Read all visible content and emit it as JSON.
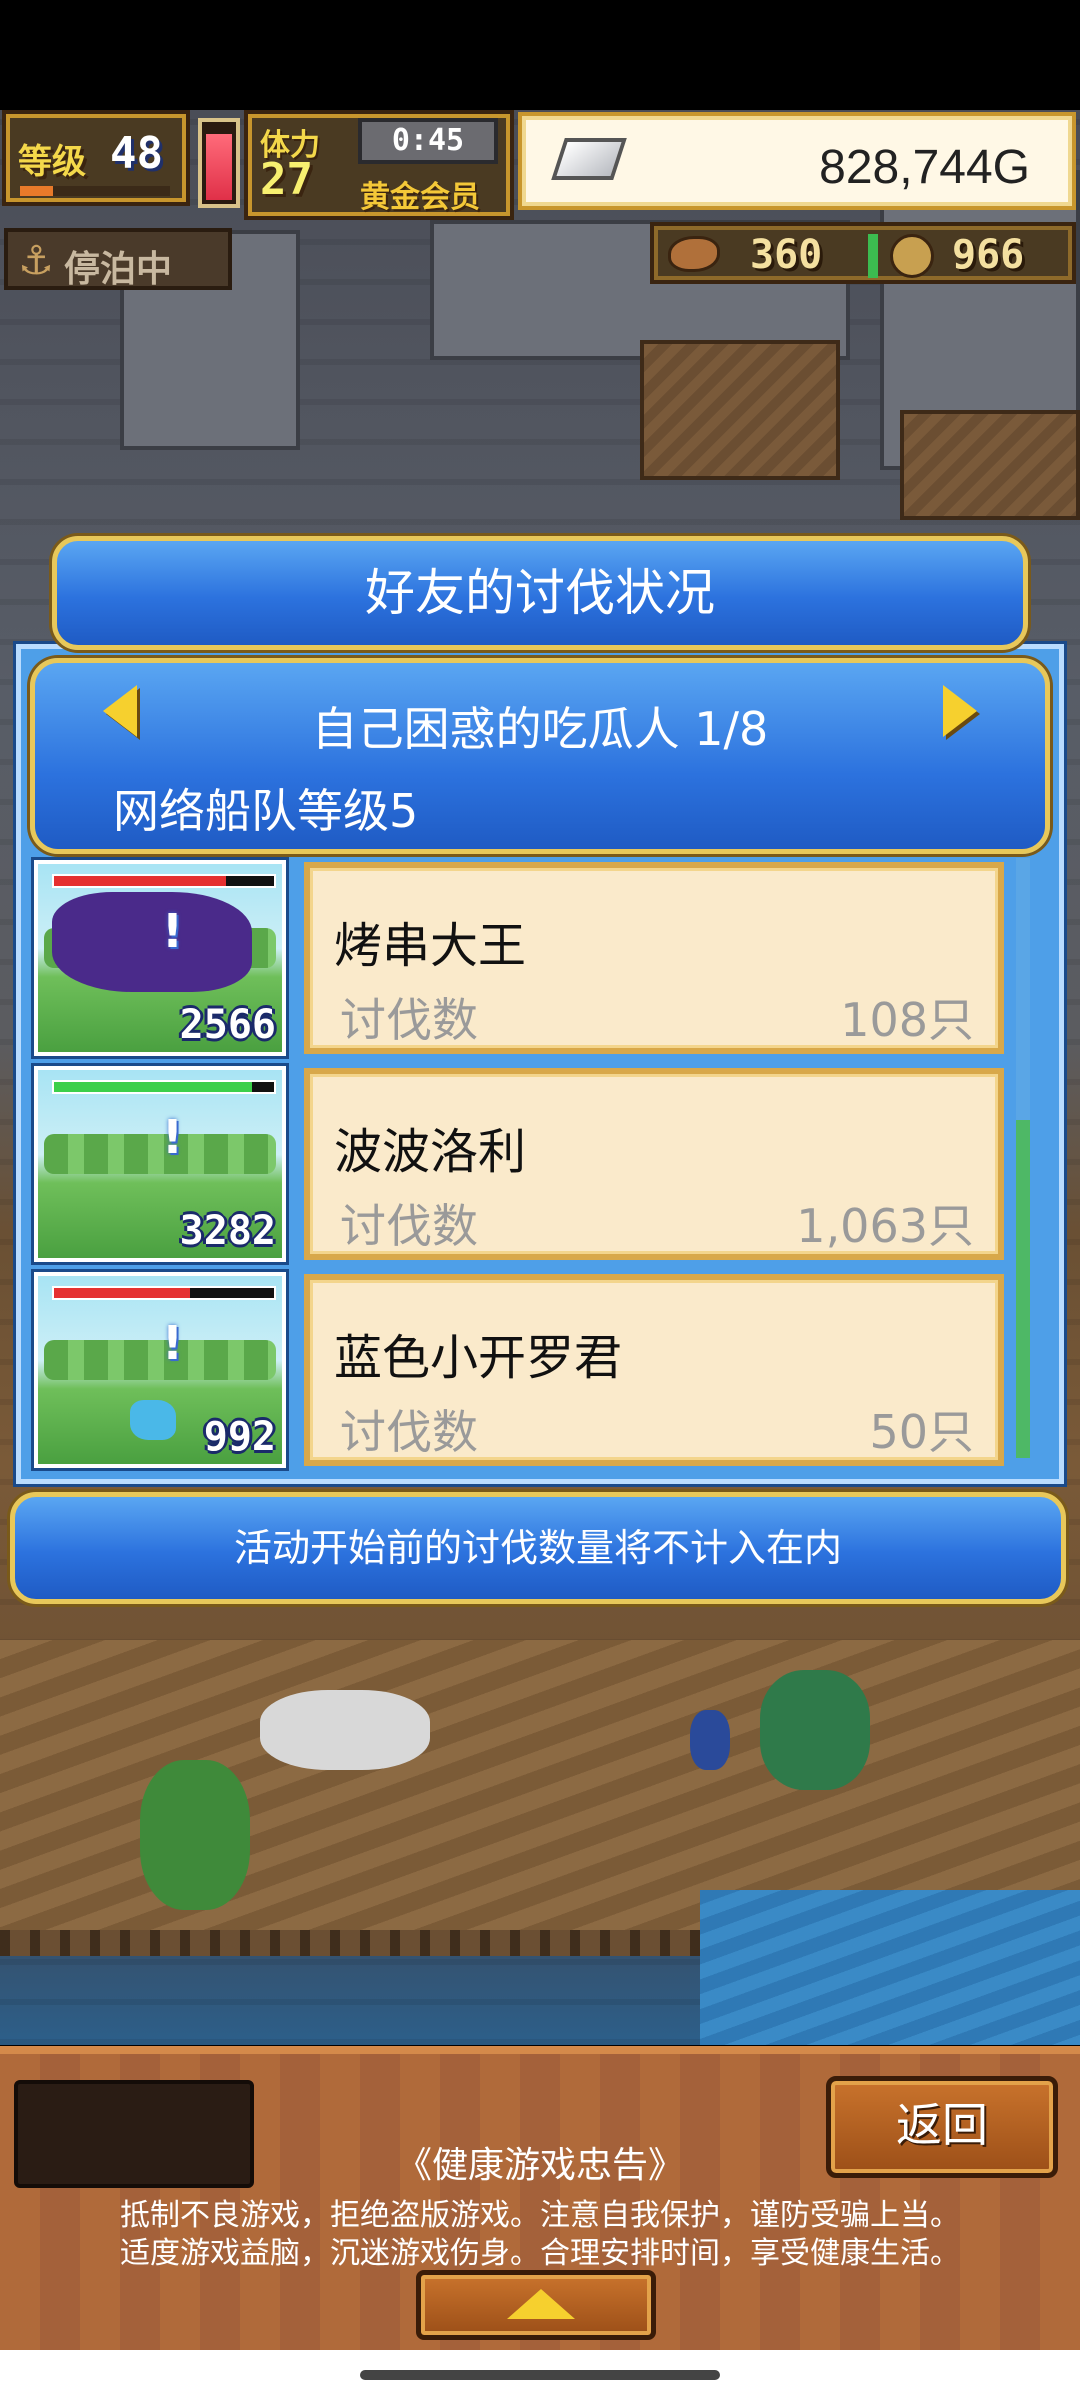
{
  "hud": {
    "level_label": "等级",
    "level_value": "48",
    "exp_fraction": 0.22,
    "stamina_fraction": 0.9,
    "stamina_label": "体力",
    "stamina_value": "27",
    "timer": "0:45",
    "membership": "黄金会员",
    "money": "828,744G",
    "docked_label": "停泊中",
    "food": "360",
    "coins": "966"
  },
  "dialog": {
    "title": "好友的讨伐状况",
    "player_name": "自己困惑的吃瓜人 1/8",
    "fleet_level": "网络船队等级5",
    "kill_label": "讨伐数",
    "entries": [
      {
        "name": "烤串大王",
        "kills": "108只",
        "score": "2566",
        "hp_fraction": 0.78,
        "hp_color": "#e53030"
      },
      {
        "name": "波波洛利",
        "kills": "1,063只",
        "score": "3282",
        "hp_fraction": 0.9,
        "hp_color": "#3ccf4a"
      },
      {
        "name": "蓝色小开罗君",
        "kills": "50只",
        "score": "992",
        "hp_fraction": 0.62,
        "hp_color": "#e53030"
      }
    ],
    "notice": "活动开始前的讨伐数量将不计入在内"
  },
  "bottom": {
    "back_label": "返回",
    "health_title": "《健康游戏忠告》",
    "health_line1": "抵制不良游戏，拒绝盗版游戏。注意自我保护，谨防受骗上当。",
    "health_line2": "适度游戏益脑，沉迷游戏伤身。合理安排时间，享受健康生活。"
  }
}
